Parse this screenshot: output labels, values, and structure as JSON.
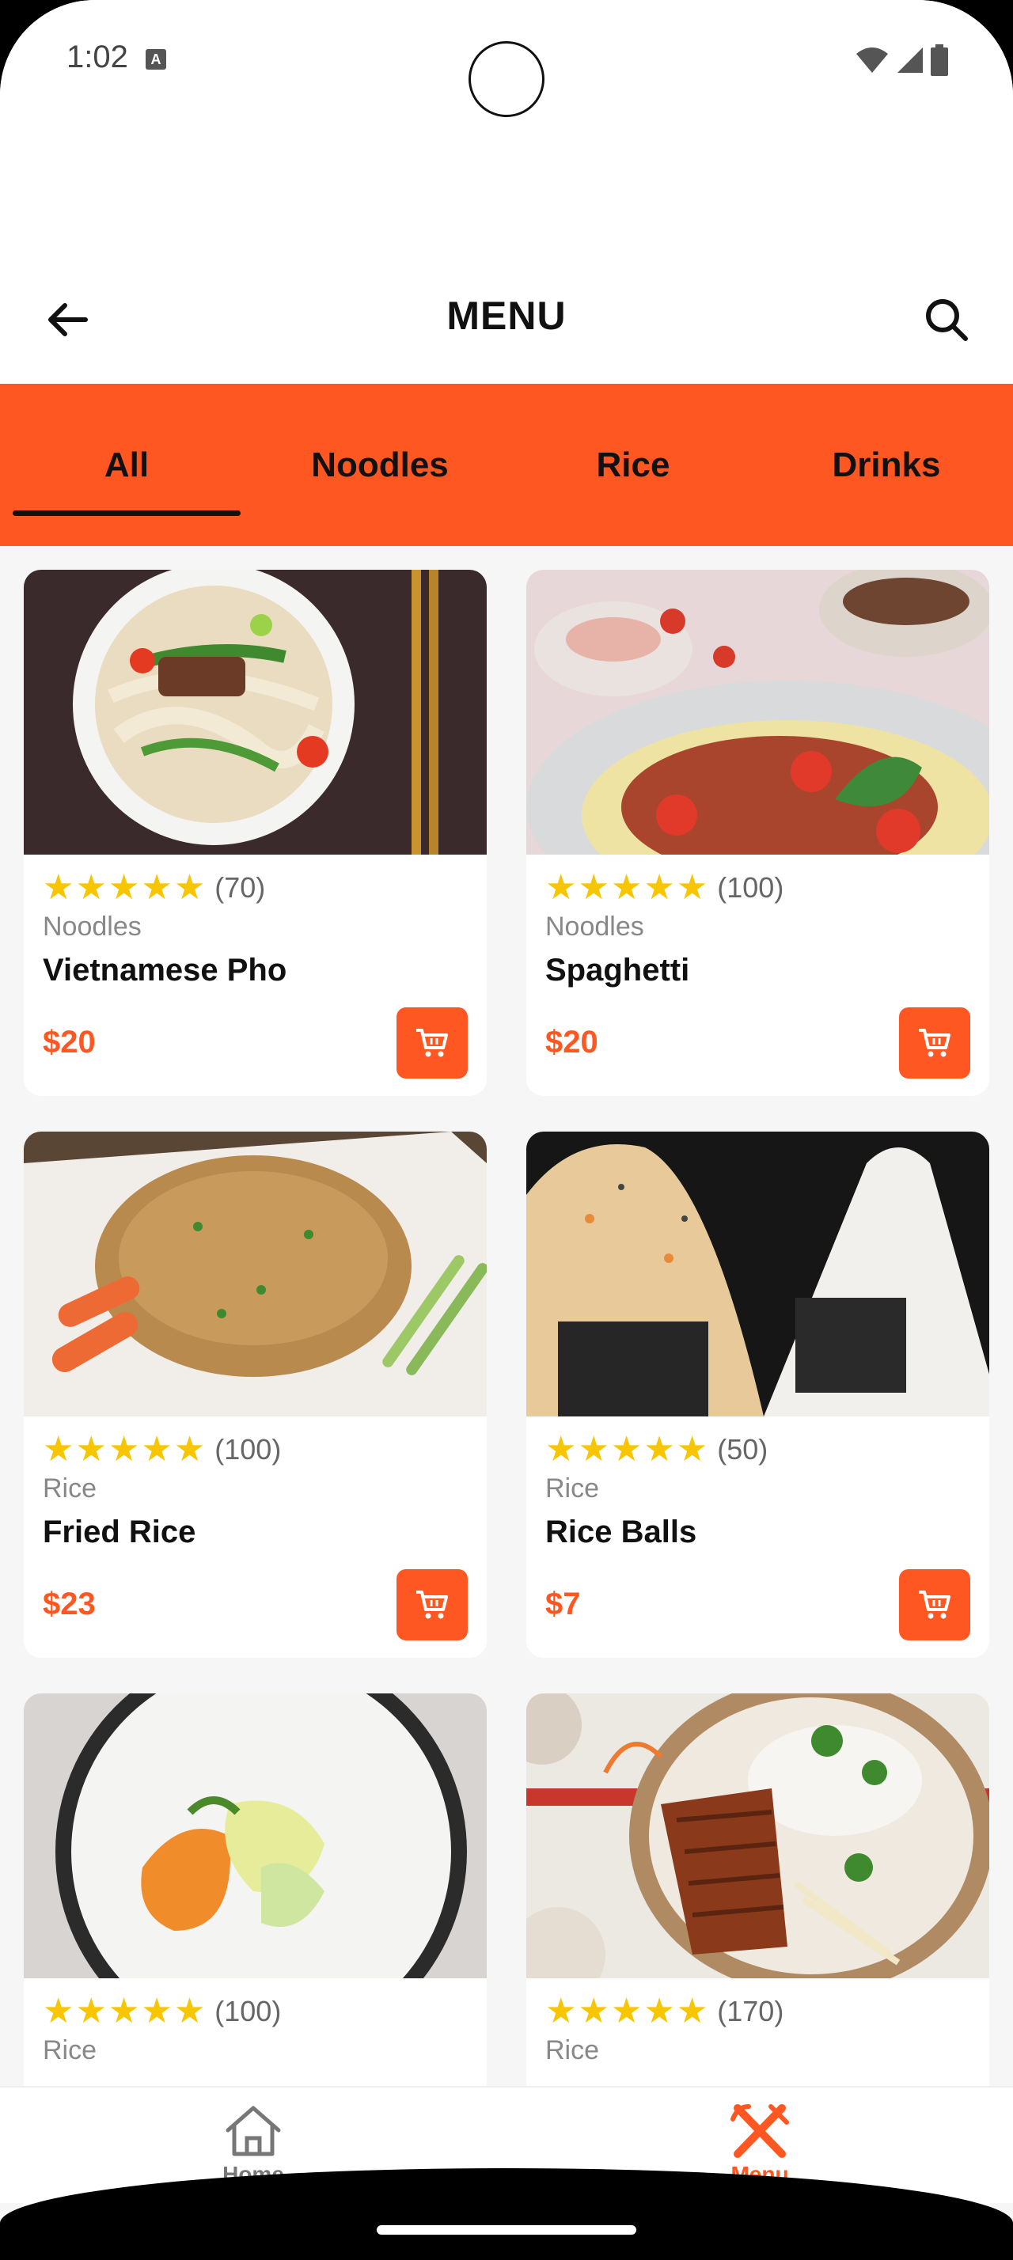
{
  "status_bar": {
    "time": "1:02",
    "a_icon": "A"
  },
  "header": {
    "title": "MENU",
    "back_icon": "arrow-left-icon",
    "search_icon": "search-icon"
  },
  "tabs": [
    {
      "label": "All",
      "active": true
    },
    {
      "label": "Noodles",
      "active": false
    },
    {
      "label": "Rice",
      "active": false
    },
    {
      "label": "Drinks",
      "active": false
    }
  ],
  "colors": {
    "accent": "#ff5722",
    "star": "#f7c600"
  },
  "products": [
    {
      "rating_stars": 5,
      "reviews": "(70)",
      "category": "Noodles",
      "name": "Vietnamese Pho",
      "price": "$20"
    },
    {
      "rating_stars": 5,
      "reviews": "(100)",
      "category": "Noodles",
      "name": "Spaghetti",
      "price": "$20"
    },
    {
      "rating_stars": 5,
      "reviews": "(100)",
      "category": "Rice",
      "name": "Fried Rice",
      "price": "$23"
    },
    {
      "rating_stars": 5,
      "reviews": "(50)",
      "category": "Rice",
      "name": "Rice Balls",
      "price": "$7"
    },
    {
      "rating_stars": 5,
      "reviews": "(100)",
      "category": "Rice",
      "name": "",
      "price": ""
    },
    {
      "rating_stars": 5,
      "reviews": "(170)",
      "category": "Rice",
      "name": "",
      "price": ""
    }
  ],
  "bottom_nav": [
    {
      "label": "Home",
      "icon": "home-icon",
      "active": false
    },
    {
      "label": "Menu",
      "icon": "fork-knife-icon",
      "active": true
    }
  ]
}
